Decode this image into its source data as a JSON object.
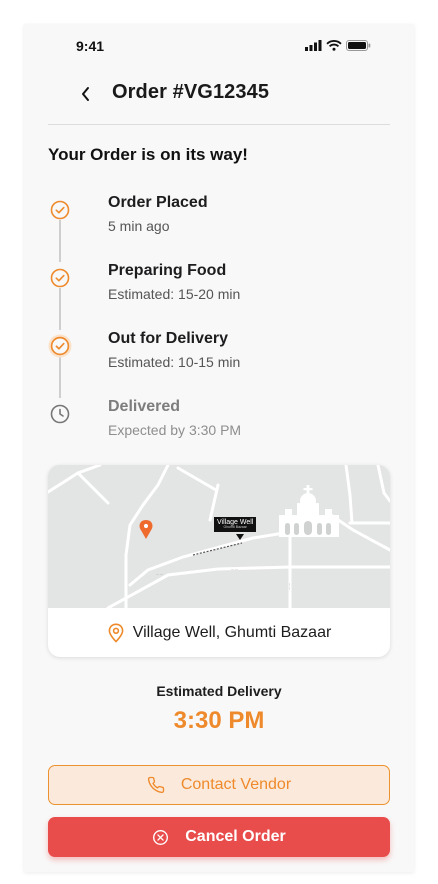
{
  "status_bar": {
    "time": "9:41",
    "icons": [
      "signal-icon",
      "wifi-icon",
      "battery-icon"
    ]
  },
  "header": {
    "title": "Order #VG12345",
    "back_icon": "chevron-left-icon"
  },
  "tracking": {
    "heading": "Your Order is on its way!",
    "steps": [
      {
        "title": "Order Placed",
        "subtitle": "5 min ago",
        "state": "complete",
        "icon": "check-circle-icon"
      },
      {
        "title": "Preparing Food",
        "subtitle": "Estimated: 15-20 min",
        "state": "complete",
        "icon": "check-circle-icon"
      },
      {
        "title": "Out for Delivery",
        "subtitle": "Estimated: 10-15 min",
        "state": "current",
        "icon": "check-circle-icon"
      },
      {
        "title": "Delivered",
        "subtitle": "Expected by 3:30 PM",
        "state": "pending",
        "icon": "clock-icon"
      }
    ]
  },
  "map": {
    "marker_label": "Village Well",
    "marker_sublabel": "Ghumti Bazaar",
    "address": "Village Well, Ghumti Bazaar",
    "address_icon": "location-pin-icon"
  },
  "delivery": {
    "label": "Estimated Delivery",
    "time": "3:30 PM"
  },
  "actions": {
    "contact_label": "Contact Vendor",
    "contact_icon": "phone-icon",
    "cancel_label": "Cancel Order",
    "cancel_icon": "x-circle-icon"
  },
  "colors": {
    "accent": "#ee8a2c",
    "danger": "#e84c4b",
    "accent_soft": "#fbeadb",
    "background": "#f8f8f8"
  }
}
